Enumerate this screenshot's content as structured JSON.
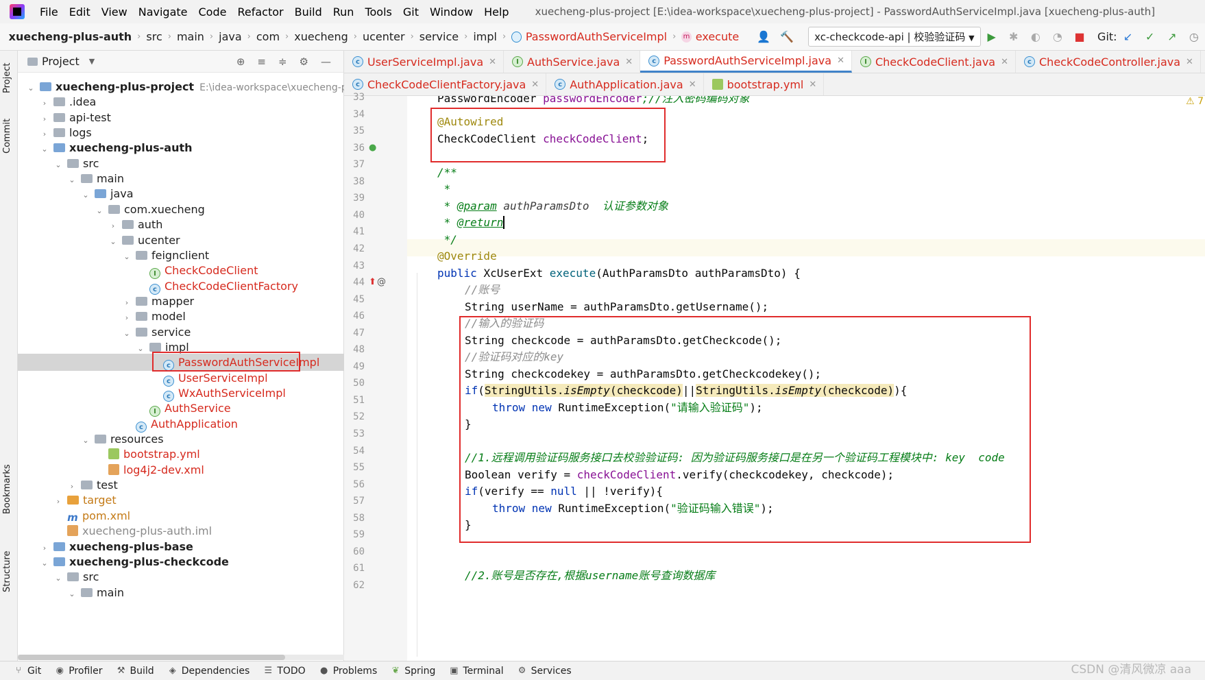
{
  "menubar": {
    "items": [
      "File",
      "Edit",
      "View",
      "Navigate",
      "Code",
      "Refactor",
      "Build",
      "Run",
      "Tools",
      "Git",
      "Window",
      "Help"
    ],
    "title": "xuecheng-plus-project [E:\\idea-workspace\\xuecheng-plus-project] - PasswordAuthServiceImpl.java [xuecheng-plus-auth]"
  },
  "navbar": {
    "crumbs": [
      "xuecheng-plus-auth",
      "src",
      "main",
      "java",
      "com",
      "xuecheng",
      "ucenter",
      "service",
      "impl",
      "PasswordAuthServiceImpl",
      "execute"
    ],
    "run_config": "xc-checkcode-api | 校验验证码",
    "git_label": "Git:"
  },
  "side_tools": {
    "project": "Project",
    "commit": "Commit",
    "bookmarks": "Bookmarks",
    "structure": "Structure"
  },
  "project_panel": {
    "title": "Project",
    "tree": [
      {
        "label": "xuecheng-plus-project",
        "extra": "E:\\idea-workspace\\xuecheng-plu",
        "bold": true
      },
      {
        "label": ".idea"
      },
      {
        "label": "api-test"
      },
      {
        "label": "logs"
      },
      {
        "label": "xuecheng-plus-auth",
        "bold": true
      },
      {
        "label": "src"
      },
      {
        "label": "main"
      },
      {
        "label": "java"
      },
      {
        "label": "com.xuecheng"
      },
      {
        "label": "auth"
      },
      {
        "label": "ucenter"
      },
      {
        "label": "feignclient"
      },
      {
        "label": "CheckCodeClient"
      },
      {
        "label": "CheckCodeClientFactory"
      },
      {
        "label": "mapper"
      },
      {
        "label": "model"
      },
      {
        "label": "service"
      },
      {
        "label": "impl"
      },
      {
        "label": "PasswordAuthServiceImpl"
      },
      {
        "label": "UserServiceImpl"
      },
      {
        "label": "WxAuthServiceImpl"
      },
      {
        "label": "AuthService"
      },
      {
        "label": "AuthApplication"
      },
      {
        "label": "resources"
      },
      {
        "label": "bootstrap.yml"
      },
      {
        "label": "log4j2-dev.xml"
      },
      {
        "label": "test"
      },
      {
        "label": "target"
      },
      {
        "label": "pom.xml"
      },
      {
        "label": "xuecheng-plus-auth.iml"
      },
      {
        "label": "xuecheng-plus-base",
        "bold": true
      },
      {
        "label": "xuecheng-plus-checkcode",
        "bold": true
      },
      {
        "label": "src"
      },
      {
        "label": "main"
      }
    ]
  },
  "editor_tabs": {
    "row1": [
      "UserServiceImpl.java",
      "AuthService.java",
      "PasswordAuthServiceImpl.java",
      "CheckCodeClient.java",
      "CheckCodeController.java"
    ],
    "row2": [
      "CheckCodeClientFactory.java",
      "AuthApplication.java",
      "bootstrap.yml"
    ],
    "active": "PasswordAuthServiceImpl.java"
  },
  "editor": {
    "warning_count": "7",
    "line_numbers": [
      "33",
      "34",
      "35",
      "36",
      "37",
      "38",
      "39",
      "40",
      "41",
      "42",
      "43",
      "44",
      "45",
      "46",
      "47",
      "48",
      "49",
      "50",
      "51",
      "52",
      "53",
      "54",
      "55",
      "56",
      "57",
      "58",
      "59",
      "60",
      "61",
      "62"
    ],
    "code": {
      "l33a": "PasswordEncoder ",
      "l33b": "passwordEncoder",
      "l33c": ";//注入密码编码对象",
      "l35": "@Autowired",
      "l36a": "CheckCodeClient ",
      "l36b": "checkCodeClient",
      "l36c": ";",
      "l38": "/**",
      "l39": " *",
      "l40a": " * ",
      "l40b": "@param",
      "l40c": " authParamsDto",
      "l40d": "  认证参数对象",
      "l41a": " * ",
      "l41b": "@return",
      "l42": " */",
      "l43": "@Override",
      "l44a": "public ",
      "l44b": "XcUserExt ",
      "l44c": "execute",
      "l44d": "(AuthParamsDto authParamsDto) {",
      "l45": "//账号",
      "l46a": "String userName = authParamsDto.",
      "l46b": "getUsername",
      "l46c": "();",
      "l47": "//输入的验证码",
      "l48a": "String checkcode = authParamsDto.",
      "l48b": "getCheckcode",
      "l48c": "();",
      "l49": "//验证码对应的key",
      "l50a": "String checkcodekey = authParamsDto.",
      "l50b": "getCheckcodekey",
      "l50c": "();",
      "l51a": "if",
      "l51b": "(",
      "l51c": "StringUtils.",
      "l51d": "isEmpty",
      "l51e": "(checkcode)",
      "l51f": "||",
      "l51g": "StringUtils.",
      "l51h": "isEmpty",
      "l51i": "(checkcode)",
      "l51j": "){",
      "l52a": "throw ",
      "l52b": "new ",
      "l52c": "RuntimeException(",
      "l52d": "\"请输入验证码\"",
      "l52e": ");",
      "l53": "}",
      "l55": "//1.远程调用验证码服务接口去校验验证码: 因为验证码服务接口是在另一个验证码工程模块中: key  code",
      "l56a": "Boolean verify = ",
      "l56b": "checkCodeClient",
      "l56c": ".verify(checkcodekey, checkcode);",
      "l57a": "if",
      "l57b": "(verify == ",
      "l57c": "null",
      "l57d": " || !verify){",
      "l58a": "throw ",
      "l58b": "new ",
      "l58c": "RuntimeException(",
      "l58d": "\"验证码输入错误\"",
      "l58e": ");",
      "l59": "}",
      "l62": "//2.账号是否存在,根据username账号查询数据库"
    }
  },
  "bottombar": {
    "tools": [
      "Git",
      "Profiler",
      "Build",
      "Dependencies",
      "TODO",
      "Problems",
      "Spring",
      "Terminal",
      "Services"
    ],
    "watermark": "CSDN @清风微凉 aaa"
  }
}
